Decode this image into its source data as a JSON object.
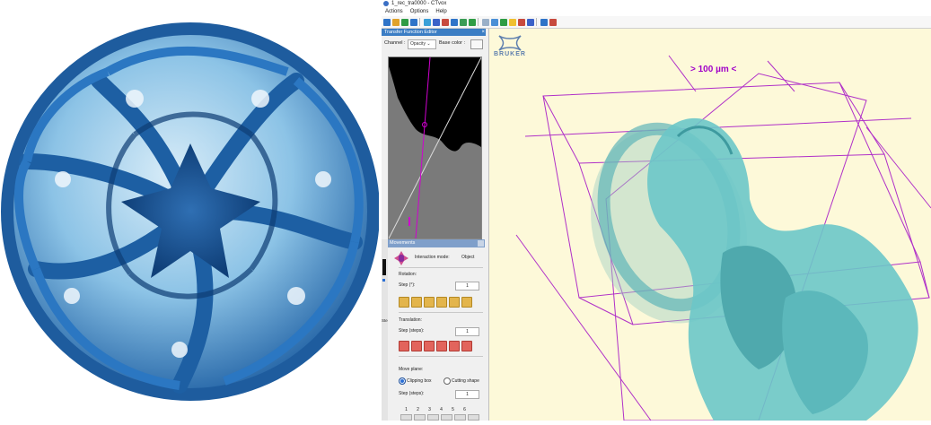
{
  "window": {
    "title": "1_rec_tra0000 - CTvox"
  },
  "menu": {
    "items": [
      "Actions",
      "Options",
      "Help"
    ]
  },
  "toolbar": {
    "icons": [
      "open-icon",
      "save-icon",
      "camera-icon",
      "settings-icon",
      "layers-icon",
      "color-icon",
      "move-icon",
      "zoom-icon",
      "view-icon",
      "palette-icon",
      "grid-icon",
      "bulb-icon",
      "measure-icon",
      "export-icon",
      "pin-icon"
    ]
  },
  "transfer_function": {
    "title": "Transfer Function Editor",
    "close": "×",
    "channel_label": "Channel :",
    "channel_value": "Opacity",
    "base_color_label": "Base color :"
  },
  "movements": {
    "title": "Movements",
    "interaction_mode_label": "Interaction mode:",
    "interaction_mode_value": "Object",
    "rotation_label": "Rotation:",
    "rotation_step_label": "Step (°):",
    "rotation_step_value": "1",
    "translation_label": "Translation:",
    "translation_step_label": "Step (steps):",
    "translation_step_value": "1",
    "move_plane_label": "Move plane:",
    "clipping_box_label": "Clipping box",
    "cutting_shape_label": "Cutting shape",
    "plane_step_label": "Step (steps):",
    "plane_step_value": "1",
    "numbers": [
      "1",
      "2",
      "3",
      "4",
      "5",
      "6"
    ]
  },
  "viewport": {
    "brand": "BRUKER",
    "scale_label": "> 100 µm <"
  },
  "side_strip": {
    "label": "Ste"
  },
  "colors": {
    "accent": "#3b7dc4",
    "viewport_bg": "#fdf9d9",
    "bounding_box": "#b030c8",
    "specimen": "#6cc6c8",
    "sphere_blue": "#1f5fa6"
  }
}
